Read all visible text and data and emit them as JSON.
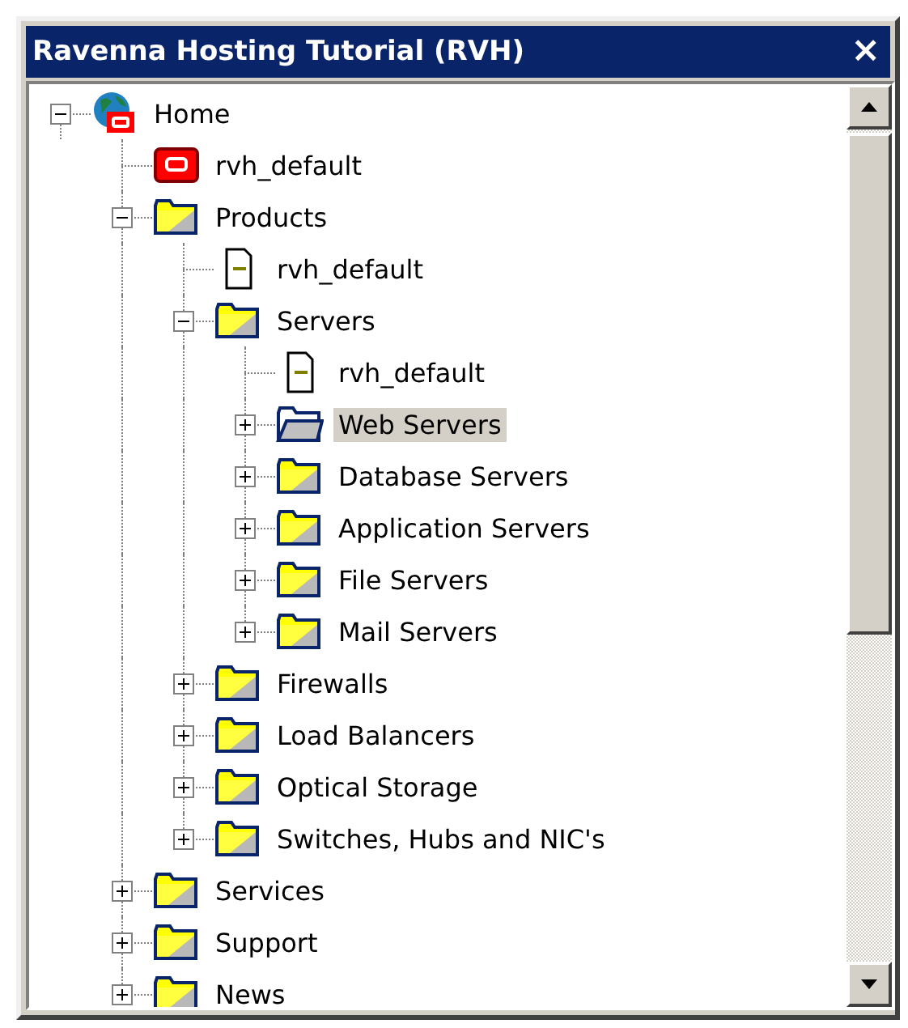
{
  "window": {
    "title": "Ravenna Hosting Tutorial (RVH)",
    "close": "×"
  },
  "tree": [
    {
      "label": "Home",
      "kind": "site",
      "expanded": true,
      "selected": false,
      "children": [
        {
          "label": "rvh_default",
          "kind": "app",
          "selected": false
        },
        {
          "label": "Products",
          "kind": "folder",
          "expanded": true,
          "selected": false,
          "children": [
            {
              "label": "rvh_default",
              "kind": "page",
              "selected": false
            },
            {
              "label": "Servers",
              "kind": "folder",
              "expanded": true,
              "selected": false,
              "children": [
                {
                  "label": "rvh_default",
                  "kind": "page",
                  "selected": false
                },
                {
                  "label": "Web Servers",
                  "kind": "folder",
                  "expanded": false,
                  "selected": true
                },
                {
                  "label": "Database Servers",
                  "kind": "folder",
                  "expanded": false,
                  "selected": false
                },
                {
                  "label": "Application Servers",
                  "kind": "folder",
                  "expanded": false,
                  "selected": false
                },
                {
                  "label": "File Servers",
                  "kind": "folder",
                  "expanded": false,
                  "selected": false
                },
                {
                  "label": "Mail Servers",
                  "kind": "folder",
                  "expanded": false,
                  "selected": false
                }
              ]
            },
            {
              "label": "Firewalls",
              "kind": "folder",
              "expanded": false,
              "selected": false
            },
            {
              "label": "Load Balancers",
              "kind": "folder",
              "expanded": false,
              "selected": false
            },
            {
              "label": "Optical Storage",
              "kind": "folder",
              "expanded": false,
              "selected": false
            },
            {
              "label": "Switches, Hubs and NIC's",
              "kind": "folder",
              "expanded": false,
              "selected": false
            }
          ]
        },
        {
          "label": "Services",
          "kind": "folder",
          "expanded": false,
          "selected": false
        },
        {
          "label": "Support",
          "kind": "folder",
          "expanded": false,
          "selected": false
        },
        {
          "label": "News",
          "kind": "folder",
          "expanded": false,
          "selected": false
        }
      ]
    }
  ]
}
